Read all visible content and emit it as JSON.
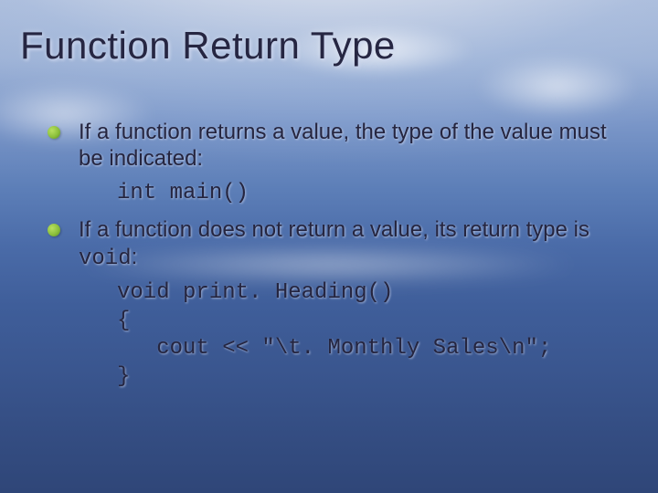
{
  "title": "Function Return Type",
  "bullet1": {
    "text": "If a function returns a value, the type of the value must be indicated:",
    "code": "int main()"
  },
  "bullet2": {
    "text_pre": "If a function does not return a value, its return type is ",
    "text_code": "void",
    "text_post": ":",
    "code_lines": {
      "l1": "void print. Heading()",
      "l2": "{",
      "l3": "   cout << \"\\t. Monthly Sales\\n\";",
      "l4": "}"
    }
  }
}
